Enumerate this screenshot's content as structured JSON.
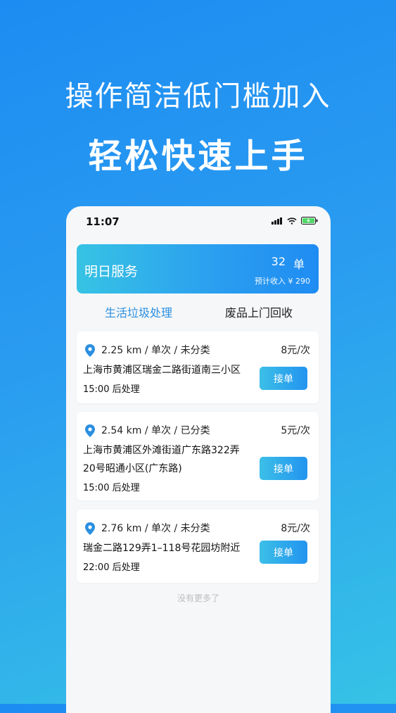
{
  "headline": {
    "line1": "操作简洁低门槛加入",
    "line2": "轻松快速上手"
  },
  "status_bar": {
    "time": "11:07",
    "icons": [
      "signal-icon",
      "wifi-icon",
      "battery-charging-icon"
    ]
  },
  "summary": {
    "title": "明日服务",
    "count": "32",
    "unit": "单",
    "income": "预计收入 ¥ 290"
  },
  "tabs": [
    {
      "label": "生活垃圾处理",
      "active": true
    },
    {
      "label": "废品上门回收",
      "active": false
    }
  ],
  "orders": [
    {
      "meta": "2.25 km / 单次 / 未分类",
      "price": "8元/次",
      "address_lines": [
        "上海市黄浦区瑞金二路街道南三小区"
      ],
      "time": "15:00 后处理",
      "button": "接单"
    },
    {
      "meta": "2.54 km / 单次 / 已分类",
      "price": "5元/次",
      "address_lines": [
        "上海市黄浦区外滩街道广东路322弄",
        "20号昭通小区(广东路)"
      ],
      "time": "15:00 后处理",
      "button": "接单"
    },
    {
      "meta": "2.76 km / 单次 / 未分类",
      "price": "8元/次",
      "address_lines": [
        "瑞金二路129弄1–118号花园坊附近"
      ],
      "time": "22:00 后处理",
      "button": "接单"
    }
  ],
  "footer_note": "没有更多了",
  "colors": {
    "accent": "#2a8fe0",
    "gradient_start": "#37c3e4",
    "gradient_end": "#1f8cf2"
  }
}
